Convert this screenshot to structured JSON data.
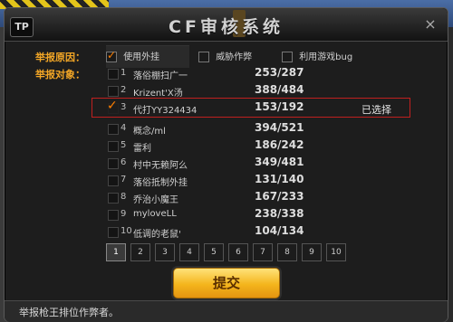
{
  "dialog": {
    "logo": "TP",
    "title": "CF审核系统",
    "close": "×"
  },
  "report": {
    "reason_label": "举报原因：",
    "target_label": "举报对象：",
    "reasons": [
      {
        "label": "使用外挂",
        "checked": true
      },
      {
        "label": "威胁作弊",
        "checked": false
      },
      {
        "label": "利用游戏bug",
        "checked": false
      }
    ],
    "rows": [
      {
        "num": "1",
        "name": "落俗棚扫广一",
        "count": "253/287",
        "checked": false,
        "status": ""
      },
      {
        "num": "2",
        "name": "Krizent'X汤",
        "count": "388/484",
        "checked": false,
        "status": ""
      },
      {
        "num": "3",
        "name": "代打YY324434",
        "count": "153/192",
        "checked": true,
        "status": "已选择"
      },
      {
        "num": "4",
        "name": "概念/ml",
        "count": "394/521",
        "checked": false,
        "status": ""
      },
      {
        "num": "5",
        "name": "雷利",
        "count": "186/242",
        "checked": false,
        "status": ""
      },
      {
        "num": "6",
        "name": "村中无赖阿么",
        "count": "349/481",
        "checked": false,
        "status": ""
      },
      {
        "num": "7",
        "name": "落俗抵制外挂",
        "count": "131/140",
        "checked": false,
        "status": ""
      },
      {
        "num": "8",
        "name": "乔治小魔王",
        "count": "167/233",
        "checked": false,
        "status": ""
      },
      {
        "num": "9",
        "name": "myloveLL",
        "count": "238/338",
        "checked": false,
        "status": ""
      },
      {
        "num": "10",
        "name": "低调的老鼠'",
        "count": "104/134",
        "checked": false,
        "status": ""
      }
    ],
    "pages": [
      "1",
      "2",
      "3",
      "4",
      "5",
      "6",
      "7",
      "8",
      "9",
      "10"
    ],
    "active_page": "1",
    "submit_label": "提交"
  },
  "footer": {
    "message": "举报枪王排位作弊者。"
  },
  "colors": {
    "accent_orange": "#f2a626",
    "check_orange": "#ff7f00",
    "selection_red": "#c0201f",
    "button_gold": "#f4b51c"
  },
  "icons": {
    "close": "close-icon",
    "check": "checkmark-icon",
    "logo": "tp-logo-icon"
  }
}
